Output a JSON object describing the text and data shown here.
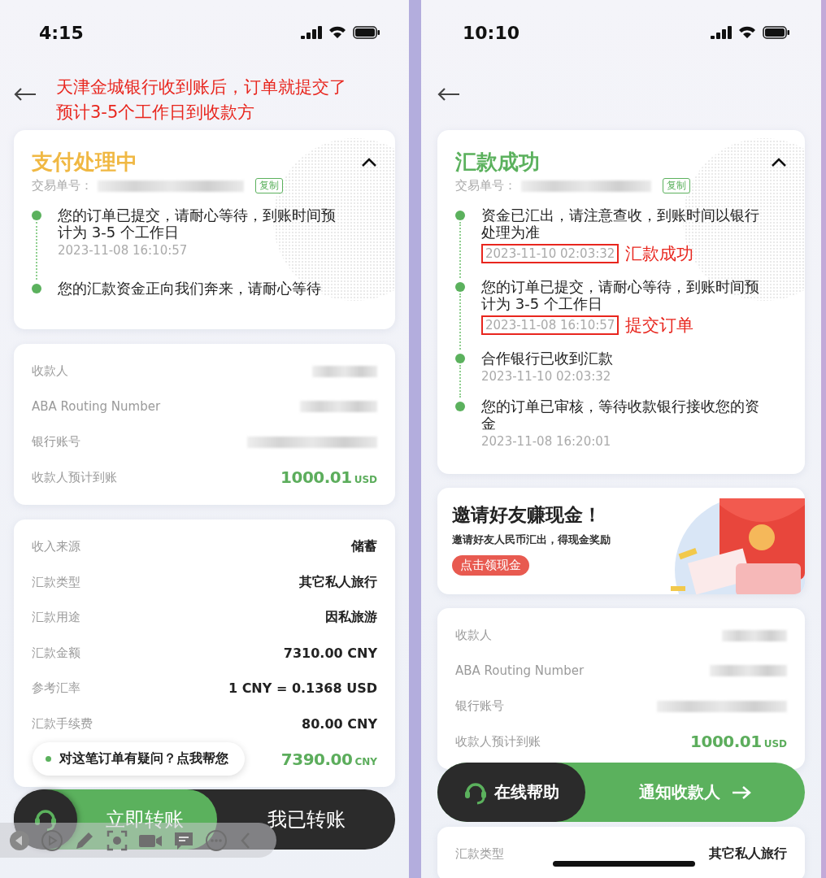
{
  "panels": [
    {
      "status_bar": {
        "time": "4:15"
      },
      "annotation": [
        "天津金城银行收到账后，订单就提交了",
        "预计3-5个工作日到收款方"
      ],
      "sections": [
        {
          "kind": "processing_card",
          "title": "支付处理中",
          "expanded": true,
          "order_label": "交易单号：",
          "copy_button": "复制",
          "timeline": [
            {
              "text": "您的订单已提交，请耐心等待，到账时间预计为 3-5 个工作日",
              "time": "2023-11-08 16:10:57"
            },
            {
              "text": "您的汇款资金正向我们奔来，请耐心等待"
            }
          ]
        },
        {
          "kind": "detail_card",
          "rows": [
            {
              "kind": "redacted",
              "label": "收款人"
            },
            {
              "kind": "redacted",
              "label": "ABA Routing Number"
            },
            {
              "kind": "redacted",
              "label": "银行账号"
            },
            {
              "kind": "amount",
              "label": "收款人预计到账",
              "value": "1000.01",
              "unit": "USD"
            }
          ]
        },
        {
          "kind": "detail_card",
          "rows": [
            {
              "kind": "text",
              "label": "收入来源",
              "value": "储蓄"
            },
            {
              "kind": "text",
              "label": "汇款类型",
              "value": "其它私人旅行"
            },
            {
              "kind": "text",
              "label": "汇款用途",
              "value": "因私旅游"
            },
            {
              "kind": "text",
              "label": "汇款金额",
              "value": "7310.00 CNY"
            },
            {
              "kind": "text",
              "label": "参考汇率",
              "value": "1 CNY = 0.1368 USD"
            },
            {
              "kind": "text",
              "label": "汇款手续费",
              "value": "80.00 CNY"
            },
            {
              "kind": "amount",
              "value": "7390.00",
              "unit": "CNY"
            }
          ],
          "help_tooltip": "对这笔订单有疑问？点我帮您"
        },
        {
          "kind": "transfer_bar",
          "primary": "立即转账",
          "secondary": "我已转账"
        }
      ],
      "capture_toolbar": {
        "kind": "overlay"
      }
    },
    {
      "status_bar": {
        "time": "10:10"
      },
      "sections": [
        {
          "kind": "success_card",
          "title": "汇款成功",
          "expanded": true,
          "order_label": "交易单号：",
          "copy_button": "复制",
          "timeline": [
            {
              "text": "资金已汇出，请注意查收，到账时间以银行处理为准",
              "time": "2023-11-10 02:03:32",
              "note": "汇款成功"
            },
            {
              "text": "您的订单已提交，请耐心等待，到账时间预计为 3-5 个工作日",
              "time": "2023-11-08 16:10:57",
              "note": "提交订单"
            },
            {
              "text": "合作银行已收到汇款",
              "time": "2023-11-10 02:03:32"
            },
            {
              "text": "您的订单已审核，等待收款银行接收您的资金",
              "time": "2023-11-08 16:20:01"
            }
          ]
        },
        {
          "kind": "promo_card",
          "title": "邀请好友赚现金！",
          "subtitle": "邀请好友人民币汇出，得现金奖励",
          "button": "点击领现金"
        },
        {
          "kind": "detail_card",
          "rows": [
            {
              "kind": "redacted",
              "label": "收款人"
            },
            {
              "kind": "redacted",
              "label": "ABA Routing Number"
            },
            {
              "kind": "redacted",
              "label": "银行账号"
            },
            {
              "kind": "amount",
              "label": "收款人预计到账",
              "value": "1000.01",
              "unit": "USD"
            }
          ]
        },
        {
          "kind": "help_bar",
          "help_label": "在线帮助",
          "primary": "通知收款人"
        },
        {
          "kind": "detail_card",
          "rows": [
            {
              "kind": "text",
              "label": "汇款类型",
              "value": "其它私人旅行"
            }
          ]
        }
      ]
    }
  ]
}
